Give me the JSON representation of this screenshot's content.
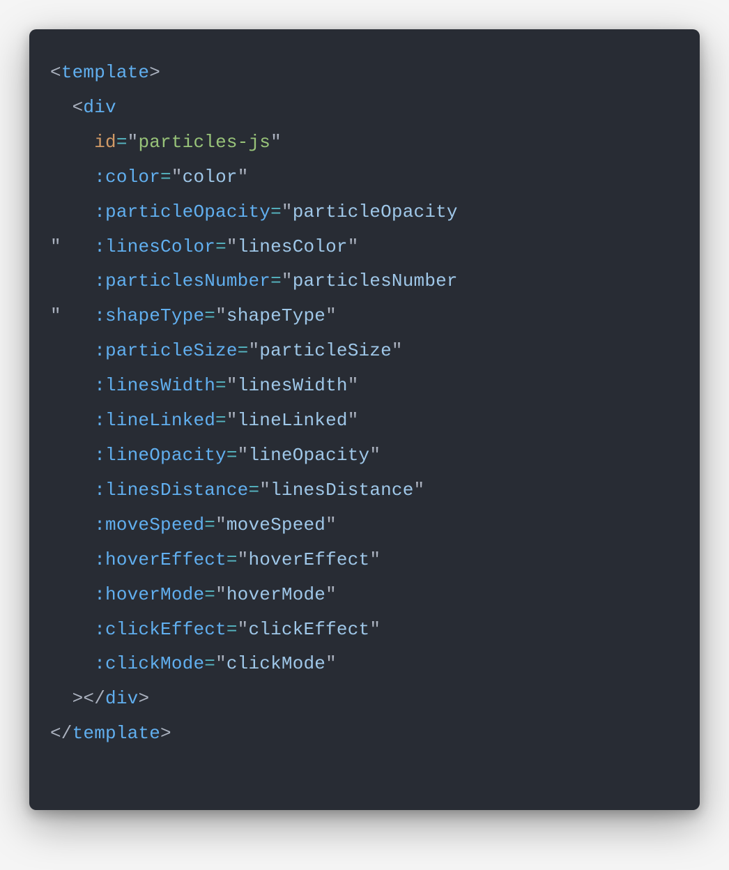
{
  "code": {
    "tag_template": "template",
    "tag_div": "div",
    "attr_id": "id",
    "val_id": "particles-js",
    "attrs": {
      "color": {
        "name": ":color",
        "value": "color"
      },
      "particleOpacity": {
        "name": ":particleOpacity",
        "value": "particleOpacity"
      },
      "linesColor": {
        "name": ":linesColor",
        "value": "linesColor"
      },
      "particlesNumber": {
        "name": ":particlesNumber",
        "value": "particlesNumber"
      },
      "shapeType": {
        "name": ":shapeType",
        "value": "shapeType"
      },
      "particleSize": {
        "name": ":particleSize",
        "value": "particleSize"
      },
      "linesWidth": {
        "name": ":linesWidth",
        "value": "linesWidth"
      },
      "lineLinked": {
        "name": ":lineLinked",
        "value": "lineLinked"
      },
      "lineOpacity": {
        "name": ":lineOpacity",
        "value": "lineOpacity"
      },
      "linesDistance": {
        "name": ":linesDistance",
        "value": "linesDistance"
      },
      "moveSpeed": {
        "name": ":moveSpeed",
        "value": "moveSpeed"
      },
      "hoverEffect": {
        "name": ":hoverEffect",
        "value": "hoverEffect"
      },
      "hoverMode": {
        "name": ":hoverMode",
        "value": "hoverMode"
      },
      "clickEffect": {
        "name": ":clickEffect",
        "value": "clickEffect"
      },
      "clickMode": {
        "name": ":clickMode",
        "value": "clickMode"
      }
    }
  }
}
